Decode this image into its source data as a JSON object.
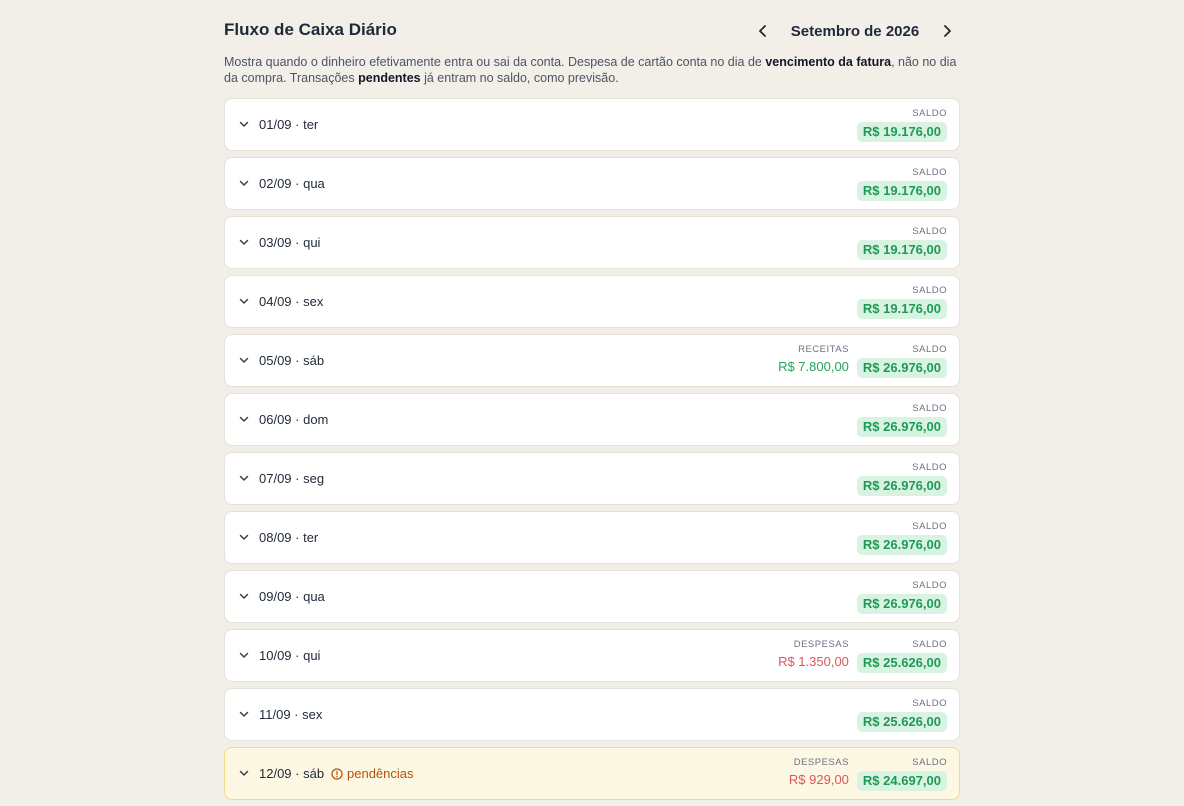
{
  "header": {
    "title": "Fluxo de Caixa Diário",
    "month": "Setembro de 2026"
  },
  "description": {
    "part1": "Mostra quando o dinheiro efetivamente entra ou sai da conta. Despesa de cartão conta no dia de ",
    "bold1": "vencimento da fatura",
    "part2": ", não no dia da compra. Transações ",
    "bold2": "pendentes",
    "part3": " já entram no saldo, como previsão."
  },
  "labels": {
    "saldo": "SALDO",
    "receitas": "RECEITAS",
    "despesas": "DESPESAS",
    "pendencias": "pendências"
  },
  "colors": {
    "income": "#22a55b",
    "expense": "#e0555b",
    "saldo_bg": "#d9f3e3",
    "pending_bg": "#fdf8e3"
  },
  "days": [
    {
      "date": "01/09 · ter",
      "saldo": "R$ 19.176,00"
    },
    {
      "date": "02/09 · qua",
      "saldo": "R$ 19.176,00"
    },
    {
      "date": "03/09 · qui",
      "saldo": "R$ 19.176,00"
    },
    {
      "date": "04/09 · sex",
      "saldo": "R$ 19.176,00"
    },
    {
      "date": "05/09 · sáb",
      "receitas": "R$ 7.800,00",
      "saldo": "R$ 26.976,00"
    },
    {
      "date": "06/09 · dom",
      "saldo": "R$ 26.976,00"
    },
    {
      "date": "07/09 · seg",
      "saldo": "R$ 26.976,00"
    },
    {
      "date": "08/09 · ter",
      "saldo": "R$ 26.976,00"
    },
    {
      "date": "09/09 · qua",
      "saldo": "R$ 26.976,00"
    },
    {
      "date": "10/09 · qui",
      "despesas": "R$ 1.350,00",
      "saldo": "R$ 25.626,00"
    },
    {
      "date": "11/09 · sex",
      "saldo": "R$ 25.626,00"
    },
    {
      "date": "12/09 · sáb",
      "pending": true,
      "despesas": "R$ 929,00",
      "saldo": "R$ 24.697,00"
    }
  ]
}
